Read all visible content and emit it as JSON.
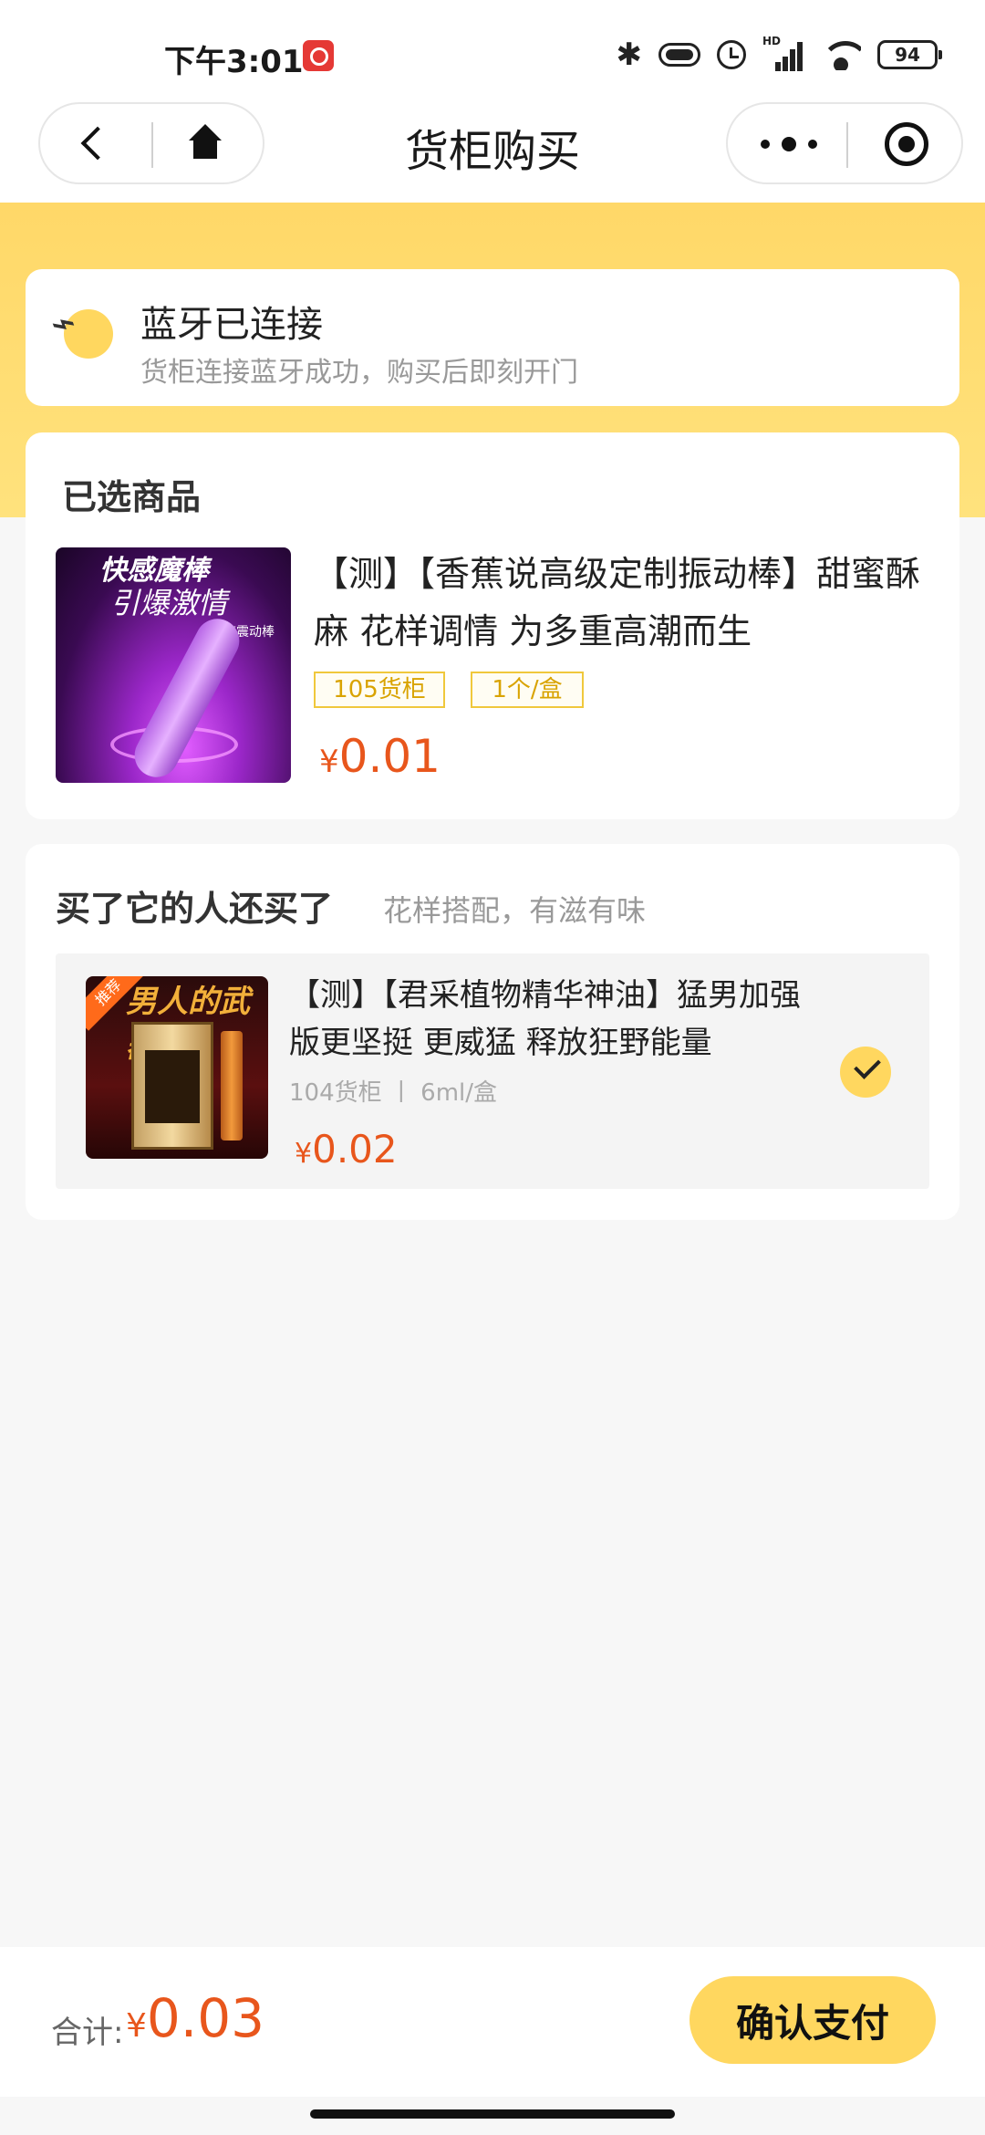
{
  "status_bar": {
    "time": "下午3:01",
    "battery": "94",
    "network": "HD"
  },
  "nav": {
    "title": "货柜购买"
  },
  "bluetooth": {
    "title": "蓝牙已连接",
    "subtitle": "货柜连接蓝牙成功，购买后即刻开门"
  },
  "selected": {
    "heading": "已选商品",
    "product": {
      "title": "【测】【香蕉说高级定制振动棒】甜蜜酥麻 花样调情 为多重高潮而生",
      "tags": [
        "105货柜",
        "1个/盒"
      ],
      "currency": "¥",
      "price": "0.01",
      "image_text": [
        "快感魔棒",
        "引爆激情",
        "多速震动棒"
      ]
    }
  },
  "recommend": {
    "heading": "买了它的人还买了",
    "subheading": "花样搭配，有滋有味",
    "item": {
      "title": "【测】【君采植物精华神油】猛男加强版更坚挺 更威猛 释放狂野能量",
      "meta": "104货柜 丨 6ml/盒",
      "currency": "¥",
      "price": "0.02",
      "image_badge": "推荐",
      "image_title": "男人的武器",
      "selected": true
    }
  },
  "footer": {
    "total_label": "合计:",
    "currency": "¥",
    "total": "0.03",
    "pay_label": "确认支付"
  },
  "colors": {
    "accent_yellow": "#ffd75f",
    "price_orange": "#e8561c",
    "tag_gold": "#d9a300"
  },
  "icons": [
    "bluetooth-icon",
    "vibrate-icon",
    "alarm-icon",
    "signal-icon",
    "wifi-icon",
    "battery-icon",
    "back-icon",
    "home-icon",
    "more-icon",
    "target-icon",
    "bluetooth-off-icon",
    "check-icon"
  ]
}
